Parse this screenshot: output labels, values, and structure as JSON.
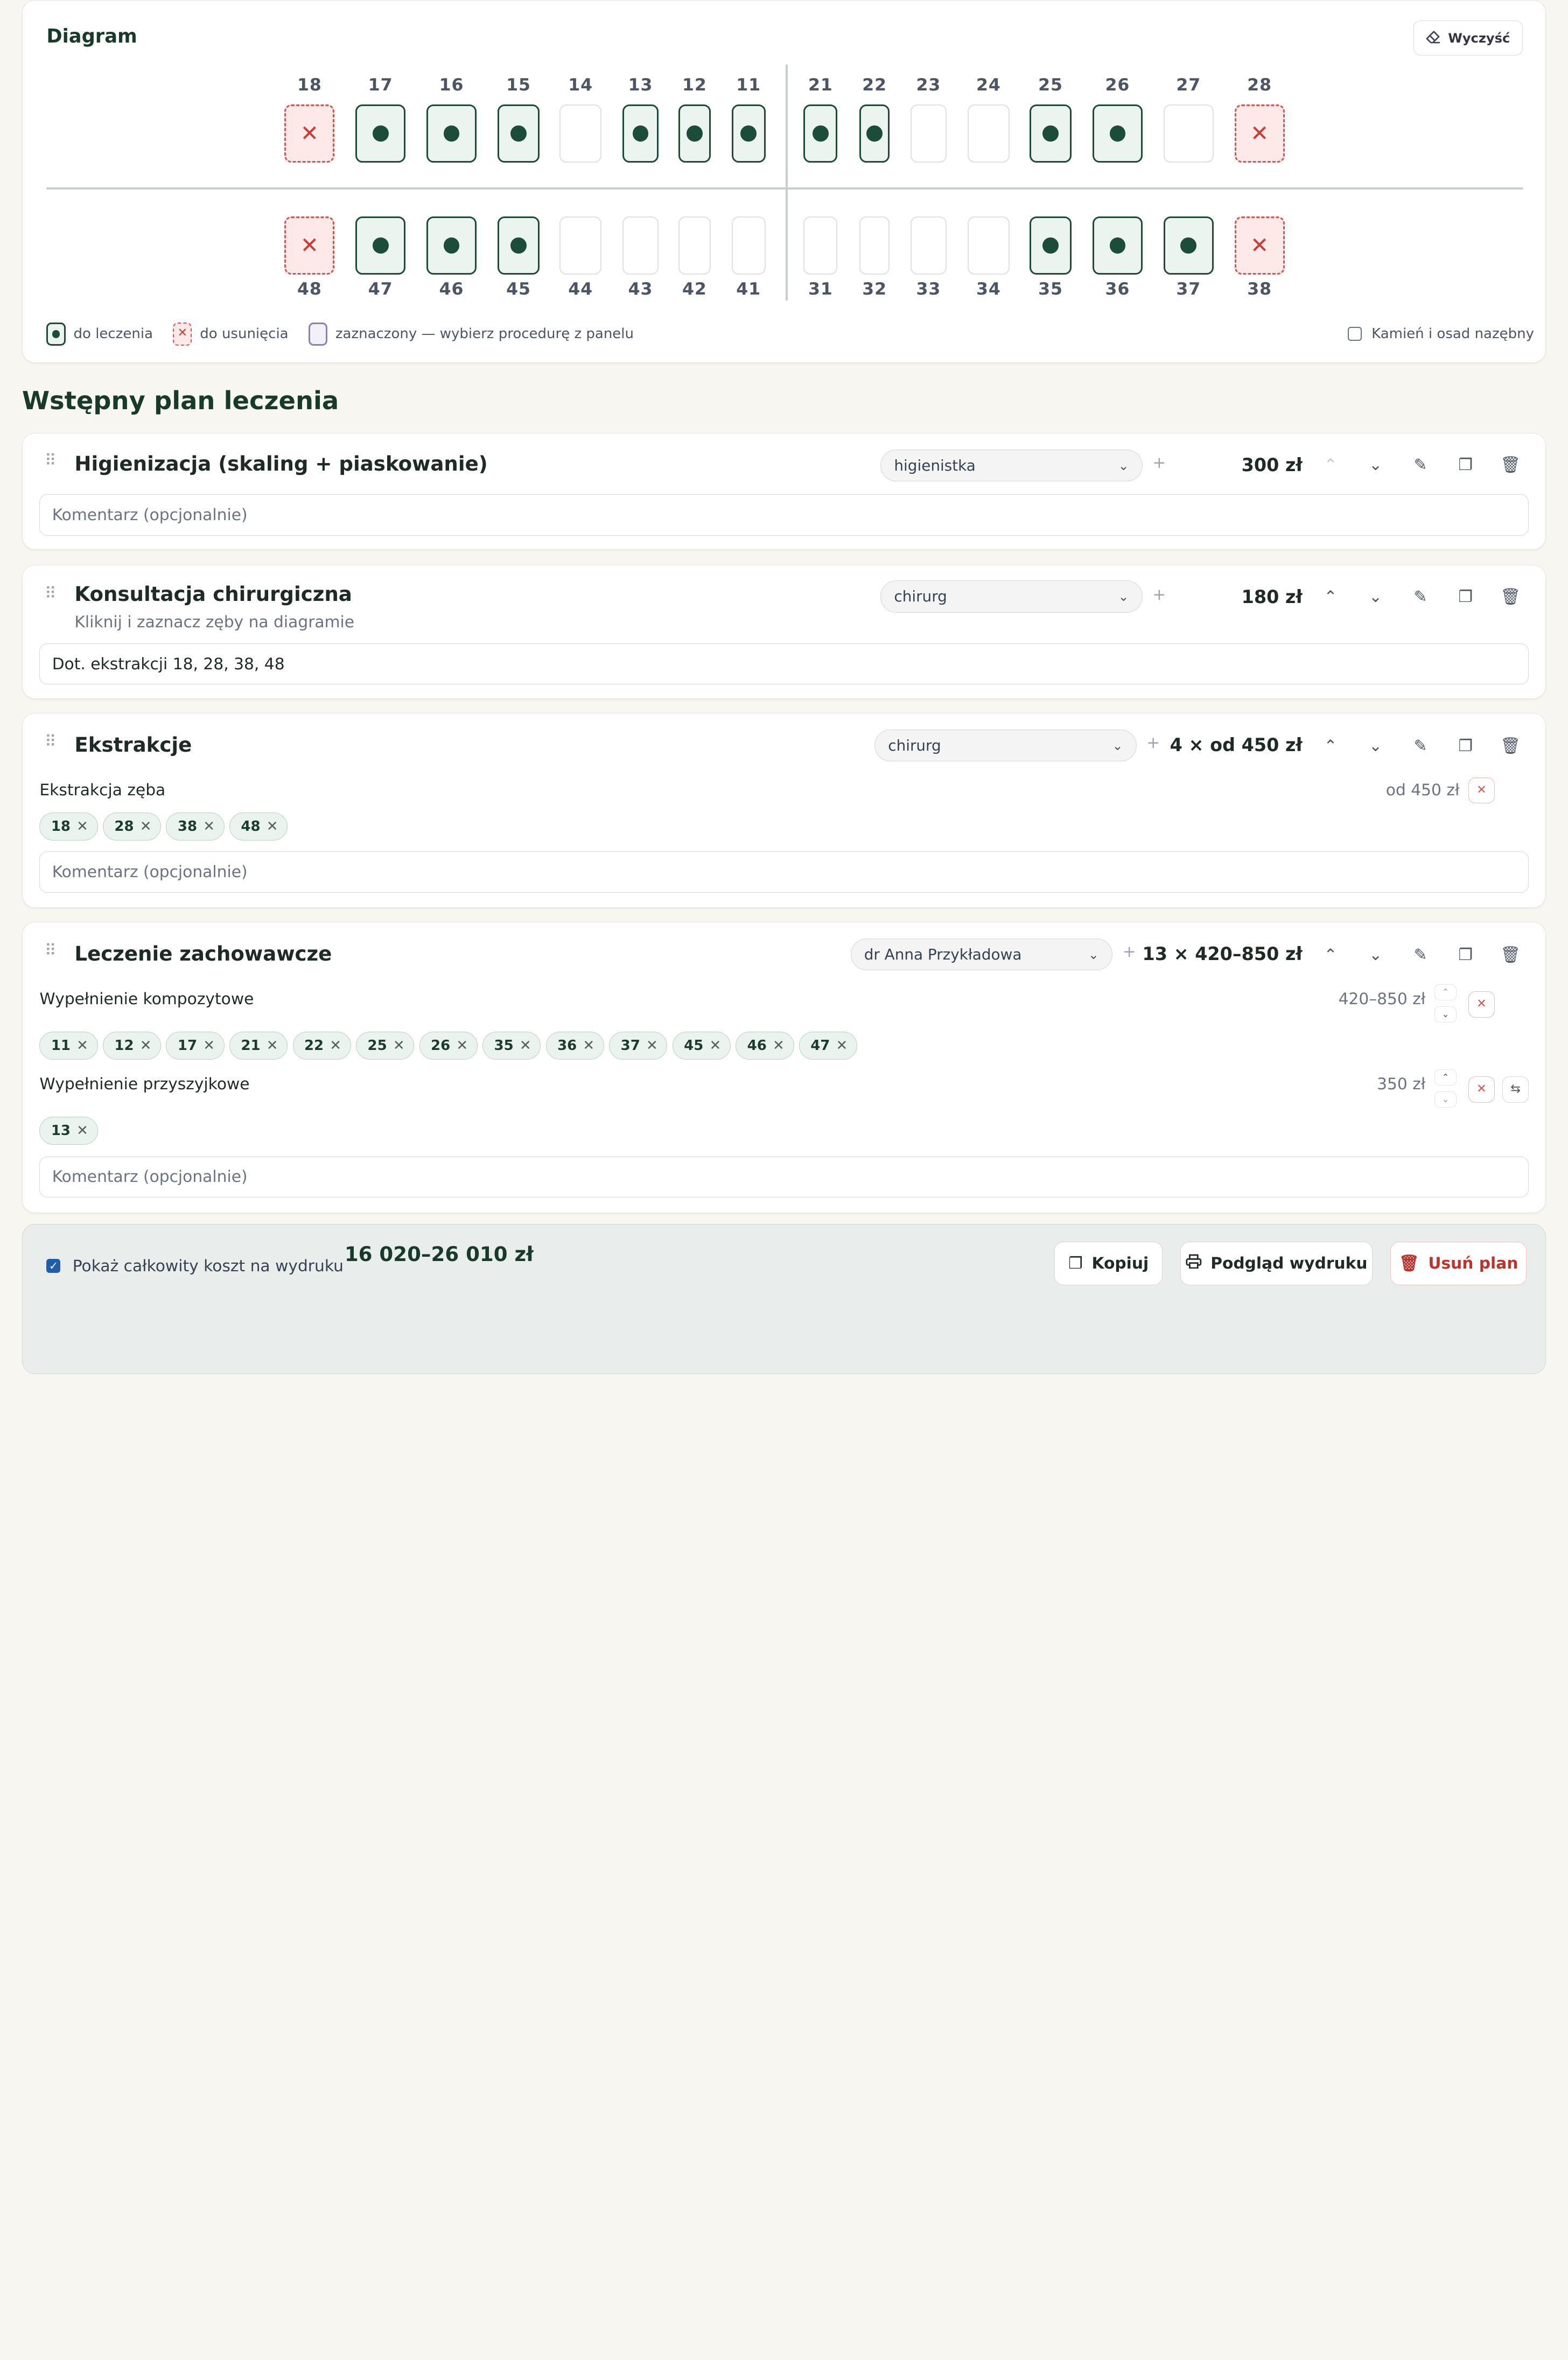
{
  "diagram": {
    "title": "Diagram",
    "clear_label": "Wyczyść",
    "upper": [
      {
        "n": "18",
        "s": "remove"
      },
      {
        "n": "17",
        "s": "treat"
      },
      {
        "n": "16",
        "s": "treat"
      },
      {
        "n": "15",
        "s": "treat"
      },
      {
        "n": "14",
        "s": "none"
      },
      {
        "n": "13",
        "s": "treat"
      },
      {
        "n": "12",
        "s": "treat"
      },
      {
        "n": "11",
        "s": "treat"
      },
      {
        "n": "21",
        "s": "treat"
      },
      {
        "n": "22",
        "s": "treat"
      },
      {
        "n": "23",
        "s": "none"
      },
      {
        "n": "24",
        "s": "none"
      },
      {
        "n": "25",
        "s": "treat"
      },
      {
        "n": "26",
        "s": "treat"
      },
      {
        "n": "27",
        "s": "none"
      },
      {
        "n": "28",
        "s": "remove"
      }
    ],
    "lower": [
      {
        "n": "48",
        "s": "remove"
      },
      {
        "n": "47",
        "s": "treat"
      },
      {
        "n": "46",
        "s": "treat"
      },
      {
        "n": "45",
        "s": "treat"
      },
      {
        "n": "44",
        "s": "none"
      },
      {
        "n": "43",
        "s": "none"
      },
      {
        "n": "42",
        "s": "none"
      },
      {
        "n": "41",
        "s": "none"
      },
      {
        "n": "31",
        "s": "none"
      },
      {
        "n": "32",
        "s": "none"
      },
      {
        "n": "33",
        "s": "none"
      },
      {
        "n": "34",
        "s": "none"
      },
      {
        "n": "35",
        "s": "treat"
      },
      {
        "n": "36",
        "s": "treat"
      },
      {
        "n": "37",
        "s": "treat"
      },
      {
        "n": "38",
        "s": "remove"
      }
    ],
    "legend": {
      "treat": "do leczenia",
      "remove": "do usunięcia",
      "selected": "zaznaczony — wybierz procedurę z panelu"
    },
    "calculus_label": "Kamień i osad nazębny",
    "calculus_checked": false
  },
  "plan": {
    "title": "Wstępny plan leczenia",
    "comment_placeholder": "Komentarz (opcjonalnie)",
    "items": [
      {
        "title": "Higienizacja (skaling + piaskowanie)",
        "role": "higienistka",
        "price": "300 zł",
        "comment": ""
      },
      {
        "title": "Konsultacja chirurgiczna",
        "subtitle": "Kliknij i zaznacz zęby na diagramie",
        "role": "chirurg",
        "price": "180 zł",
        "comment": "Dot. ekstrakcji 18, 28, 38, 48"
      },
      {
        "title": "Ekstrakcje",
        "role": "chirurg",
        "price": "4 × od 450 zł",
        "procedures": [
          {
            "name": "Ekstrakcja zęba",
            "price": "od 450 zł",
            "teeth": [
              "18",
              "28",
              "38",
              "48"
            ]
          }
        ],
        "comment": ""
      },
      {
        "title": "Leczenie zachowawcze",
        "role": "dr Anna Przykładowa",
        "price": "13 × 420–850 zł",
        "procedures": [
          {
            "name": "Wypełnienie kompozytowe",
            "price": "420–850 zł",
            "teeth": [
              "11",
              "12",
              "17",
              "21",
              "22",
              "25",
              "26",
              "35",
              "36",
              "37",
              "45",
              "46",
              "47"
            ]
          },
          {
            "name": "Wypełnienie przyszyjkowe",
            "price": "350 zł",
            "teeth": [
              "13"
            ]
          }
        ],
        "comment": ""
      }
    ]
  },
  "footer": {
    "show_total_label": "Pokaż całkowity koszt na wydruku",
    "show_total_checked": true,
    "total": "16 020–26 010 zł",
    "copy_label": "Kopiuj",
    "preview_label": "Podgląd wydruku",
    "delete_label": "Usuń plan"
  },
  "colors": {
    "accent": "#1b4d38",
    "remove": "#d9534f",
    "selected": "#8d7fb5",
    "background": "#f8f6f0"
  }
}
